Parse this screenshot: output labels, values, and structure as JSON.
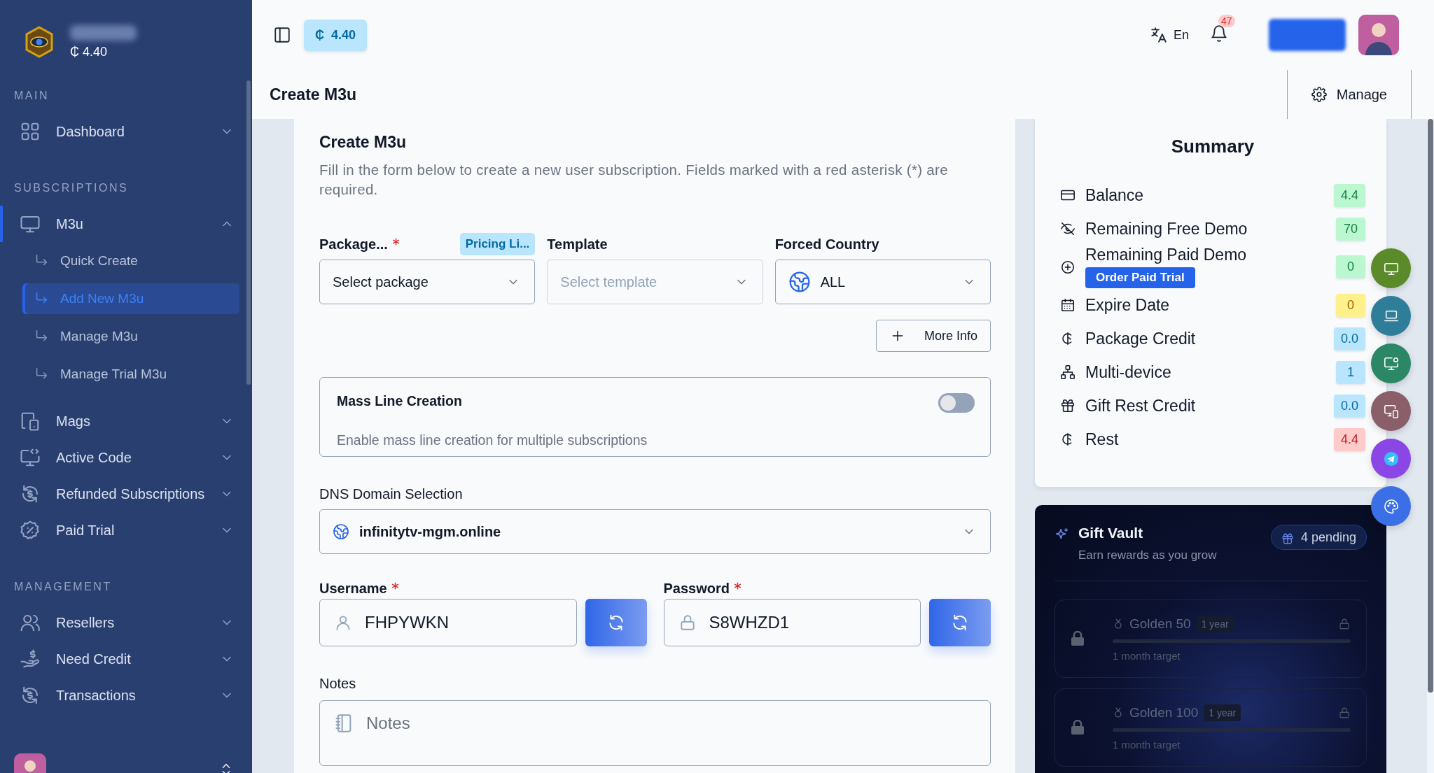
{
  "sidebar": {
    "balance": "₵ 4.40",
    "sections": [
      {
        "title": "MAIN",
        "items": [
          {
            "label": "Dashboard",
            "selected": false,
            "expanded": false
          }
        ]
      },
      {
        "title": "SUBSCRIPTIONS",
        "items": [
          {
            "label": "M3u",
            "selected": true,
            "expanded": true,
            "children": [
              {
                "label": "Quick Create",
                "selected": false
              },
              {
                "label": "Add New M3u",
                "selected": true
              },
              {
                "label": "Manage M3u",
                "selected": false
              },
              {
                "label": "Manage Trial M3u",
                "selected": false
              }
            ]
          },
          {
            "label": "Mags",
            "selected": false,
            "expanded": false
          },
          {
            "label": "Active Code",
            "selected": false,
            "expanded": false
          },
          {
            "label": "Refunded Subscriptions",
            "selected": false,
            "expanded": false
          },
          {
            "label": "Paid Trial",
            "selected": false,
            "expanded": false
          }
        ]
      },
      {
        "title": "MANAGEMENT",
        "items": [
          {
            "label": "Resellers",
            "selected": false,
            "expanded": false
          },
          {
            "label": "Need Credit",
            "selected": false,
            "expanded": false
          },
          {
            "label": "Transactions",
            "selected": false,
            "expanded": false
          }
        ]
      }
    ]
  },
  "topbar": {
    "credit": "₵  4.40",
    "language": "En",
    "notifications": "47"
  },
  "header": {
    "title": "Create M3u",
    "action": "Manage"
  },
  "form": {
    "title": "Create M3u",
    "description": "Fill in the form below to create a new user subscription. Fields marked with a red asterisk (*) are required.",
    "package": {
      "label": "Package...",
      "required": true,
      "badge": "Pricing Li...",
      "value": "Select package"
    },
    "template": {
      "label": "Template",
      "placeholder": "Select template",
      "disabled": true
    },
    "country": {
      "label": "Forced Country",
      "value": "ALL"
    },
    "more_info": "More Info",
    "mass_line": {
      "title": "Mass Line Creation",
      "description": "Enable mass line creation for multiple subscriptions",
      "on": false
    },
    "dns": {
      "label": "DNS Domain Selection",
      "value": "infinitytv-mgm.online"
    },
    "username": {
      "label": "Username",
      "required": true,
      "value": "FHPYWKN"
    },
    "password": {
      "label": "Password",
      "required": true,
      "value": "S8WHZD1"
    },
    "notes": {
      "label": "Notes",
      "placeholder": "Notes"
    }
  },
  "summary": {
    "title": "Summary",
    "rows": [
      {
        "label": "Balance",
        "value": "4.4",
        "color": "#bbf7d0"
      },
      {
        "label": "Remaining Free Demo",
        "value": "70",
        "color": "#bbf7d0"
      },
      {
        "label": "Remaining Paid Demo",
        "value": "0",
        "color": "#bbf7d0",
        "action": "Order Paid Trial"
      },
      {
        "label": "Expire Date",
        "value": "0",
        "color": "#fef08a"
      },
      {
        "label": "Package Credit",
        "value": "0.0",
        "color": "#bae6fd"
      },
      {
        "label": "Multi-device",
        "value": "1",
        "color": "#bae6fd"
      },
      {
        "label": "Gift Rest Credit",
        "value": "0.0",
        "color": "#bae6fd"
      },
      {
        "label": "Rest",
        "value": "4.4",
        "color": "#fecaca"
      }
    ]
  },
  "floating_buttons": [
    {
      "color": "#5b8a2a"
    },
    {
      "color": "#2e7d99"
    },
    {
      "color": "#2b8766"
    },
    {
      "color": "#8a5f6a"
    },
    {
      "color": "#8b47e6"
    },
    {
      "color": "#3b6fe6"
    }
  ],
  "gift_vault": {
    "title": "Gift Vault",
    "subtitle": "Earn rewards as you grow",
    "pending": "4 pending",
    "rewards": [
      {
        "name": "Golden 50",
        "period": "1 year",
        "target": "1 month target",
        "locked": true,
        "level": 0
      },
      {
        "name": "Golden 100",
        "period": "1 year",
        "target": "1 month target",
        "locked": true,
        "level": 0
      }
    ]
  }
}
